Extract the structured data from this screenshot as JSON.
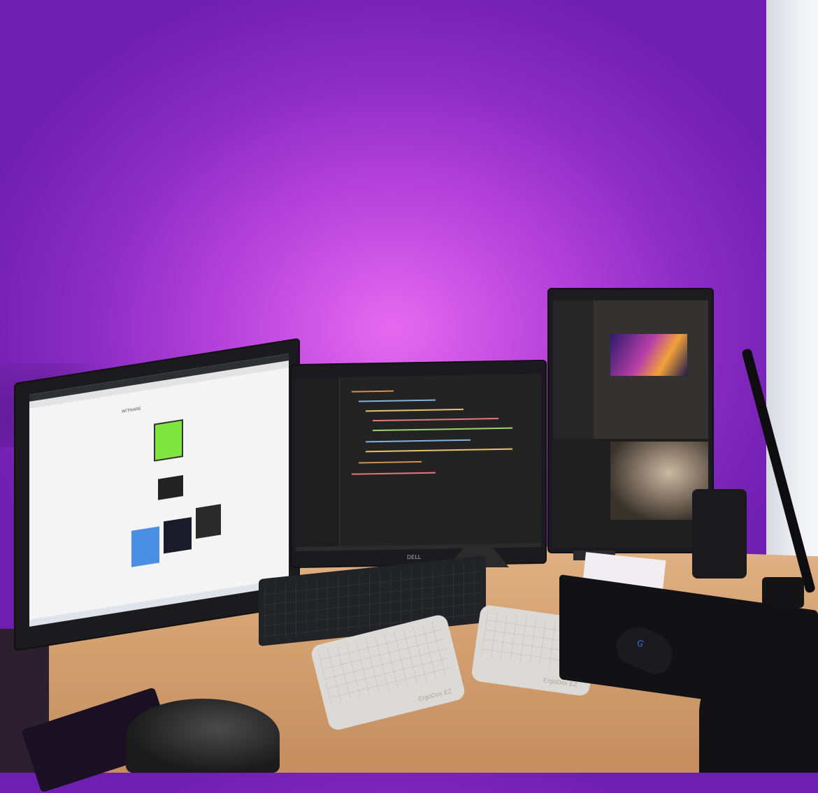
{
  "scene": {
    "description_tag": "desk-setup-photo"
  },
  "left_monitor": {
    "screen_title": "WiTHARE"
  },
  "keyboard_split": {
    "brand_label": "ErgoDox EZ"
  },
  "mouse": {
    "logo": "G"
  },
  "middle_monitor": {
    "brand": "DELL"
  }
}
